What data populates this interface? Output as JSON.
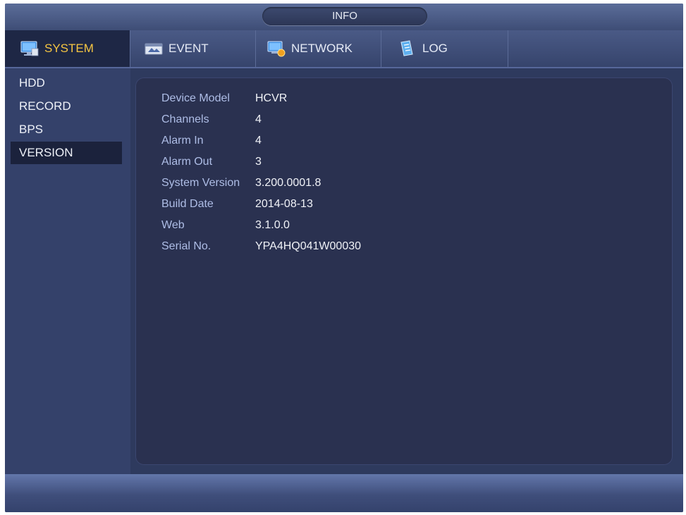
{
  "window": {
    "title": "INFO"
  },
  "tabs": [
    {
      "label": "SYSTEM",
      "icon": "system-monitor-icon",
      "active": true
    },
    {
      "label": "EVENT",
      "icon": "event-icon",
      "active": false
    },
    {
      "label": "NETWORK",
      "icon": "network-icon",
      "active": false
    },
    {
      "label": "LOG",
      "icon": "log-icon",
      "active": false
    }
  ],
  "sidebar": {
    "items": [
      {
        "label": "HDD"
      },
      {
        "label": "RECORD"
      },
      {
        "label": "BPS"
      },
      {
        "label": "VERSION",
        "active": true
      }
    ]
  },
  "version_info": [
    {
      "label": "Device Model",
      "value": "HCVR"
    },
    {
      "label": "Channels",
      "value": "4"
    },
    {
      "label": "Alarm In",
      "value": "4"
    },
    {
      "label": "Alarm Out",
      "value": "3"
    },
    {
      "label": "System Version",
      "value": "3.200.0001.8"
    },
    {
      "label": "Build Date",
      "value": "2014-08-13"
    },
    {
      "label": "Web",
      "value": "3.1.0.0"
    },
    {
      "label": "Serial No.",
      "value": "YPA4HQ041W00030"
    }
  ],
  "colors": {
    "active_tab_text": "#f5c542",
    "label_text": "#aebde6"
  }
}
